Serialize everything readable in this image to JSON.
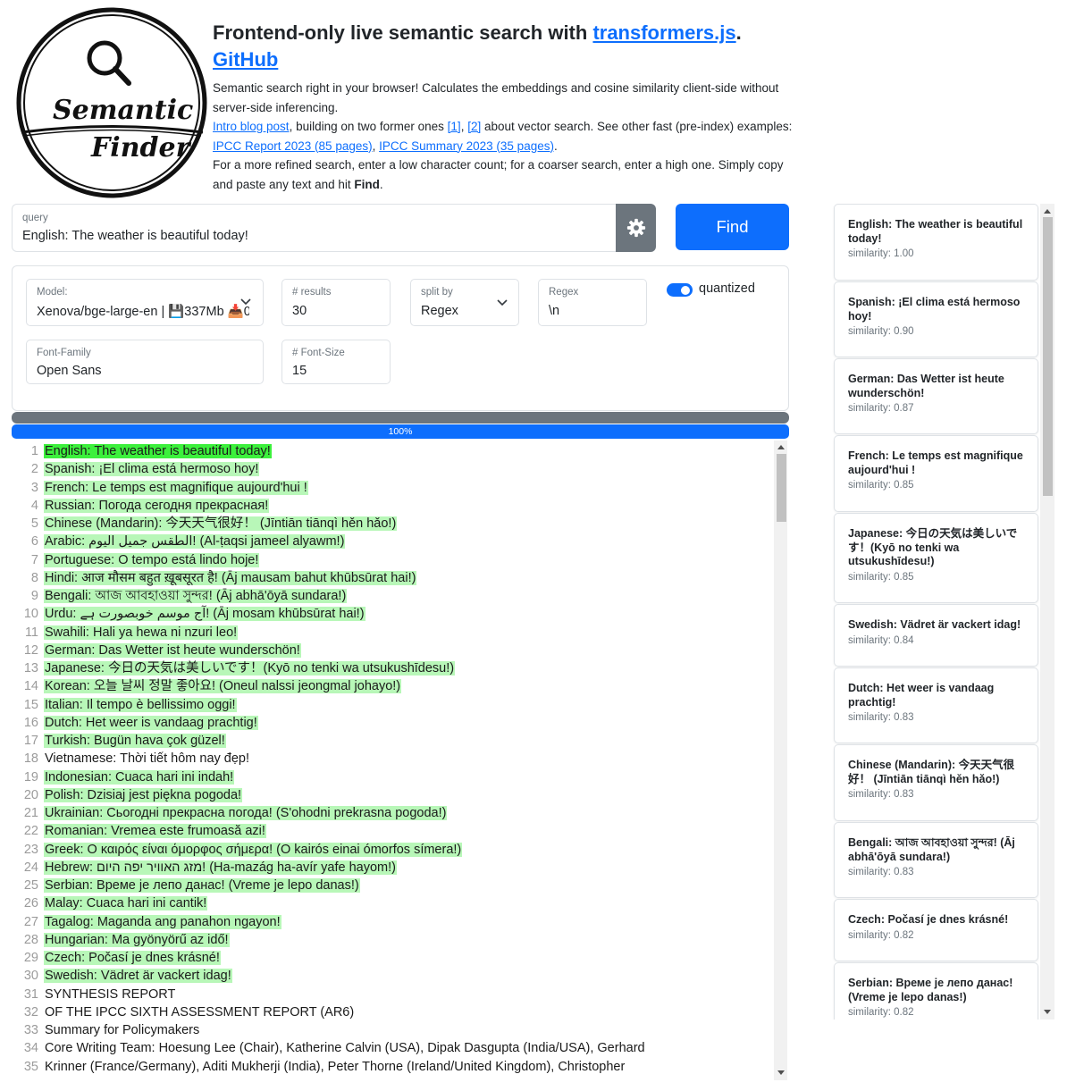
{
  "logo": {
    "word1": "Semantic",
    "word2": "Finder"
  },
  "header": {
    "title_prefix": "Frontend-only live semantic search with ",
    "title_link1": "transformers.js",
    "title_sep": ". ",
    "title_link2": "GitHub",
    "p1": "Semantic search right in your browser! Calculates the embeddings and cosine similarity client-side without server-side inferencing.",
    "p2_link_intro": "Intro blog post",
    "p2_text1": ", building on two former ones ",
    "p2_link_1": "[1]",
    "p2_text2": ", ",
    "p2_link_2": "[2]",
    "p2_text3": " about vector search. See other fast (pre-index) examples: ",
    "p2_link_ipcc_report": "IPCC Report 2023 (85 pages)",
    "p2_text4": ", ",
    "p2_link_ipcc_summary": "IPCC Summary 2023 (35 pages)",
    "p2_text5": ".",
    "p3_text": "For a more refined search, enter a low character count; for a coarser search, enter a high one. Simply copy and paste any text and hit ",
    "p3_bold": "Find",
    "p3_end": "."
  },
  "query": {
    "label": "query",
    "value": "English: The weather is beautiful today!"
  },
  "find_label": "Find",
  "settings": {
    "model_label": "Model:",
    "model_value": "Xenova/bge-large-en | 💾337Mb 📥0",
    "results_label": "# results",
    "results_value": "30",
    "split_label": "split by",
    "split_value": "Regex",
    "regex_label": "Regex",
    "regex_value": "\\n",
    "quantized_label": "quantized",
    "font_family_label": "Font-Family",
    "font_family_value": "Open Sans",
    "font_size_label": "# Font-Size",
    "font_size_value": "15"
  },
  "progress": {
    "label": "100%",
    "value": 100
  },
  "colors": {
    "primary": "#0d6efd",
    "secondary": "#6c757d",
    "top_highlight": "#3cf03c",
    "highlight": "#b8f7b8"
  },
  "editor": {
    "lines": [
      {
        "n": "1",
        "text": "English: The weather is beautiful today!",
        "level": "top"
      },
      {
        "n": "2",
        "text": "Spanish: ¡El clima está hermoso hoy!",
        "level": "high"
      },
      {
        "n": "3",
        "text": "French: Le temps est magnifique aujourd'hui !",
        "level": "high"
      },
      {
        "n": "4",
        "text": "Russian: Погода сегодня прекрасная!",
        "level": "high"
      },
      {
        "n": "5",
        "text": "Chinese (Mandarin): 今天天气很好！ (Jīntiān tiānqì hěn hǎo!)",
        "level": "high"
      },
      {
        "n": "6",
        "text": "Arabic: الطقس جميل اليوم! (Al-ṭaqsi jameel alyawm!)",
        "level": "high"
      },
      {
        "n": "7",
        "text": "Portuguese: O tempo está lindo hoje!",
        "level": "high"
      },
      {
        "n": "8",
        "text": "Hindi: आज मौसम बहुत ख़ूबसूरत है! (Āj mausam bahut khūbsūrat hai!)",
        "level": "high"
      },
      {
        "n": "9",
        "text": "Bengali: আজ আবহাওয়া সুন্দর! (Āj abhā'ōyā sundara!)",
        "level": "high"
      },
      {
        "n": "10",
        "text": "Urdu: آج موسم خوبصورت ہے! (Āj mosam khūbsūrat hai!)",
        "level": "high"
      },
      {
        "n": "11",
        "text": "Swahili: Hali ya hewa ni nzuri leo!",
        "level": "high"
      },
      {
        "n": "12",
        "text": "German: Das Wetter ist heute wunderschön!",
        "level": "high"
      },
      {
        "n": "13",
        "text": "Japanese: 今日の天気は美しいです！(Kyō no tenki wa utsukushīdesu!)",
        "level": "high"
      },
      {
        "n": "14",
        "text": "Korean: 오늘 날씨 정말 좋아요! (Oneul nalssi jeongmal johayo!)",
        "level": "high"
      },
      {
        "n": "15",
        "text": "Italian: Il tempo è bellissimo oggi!",
        "level": "high"
      },
      {
        "n": "16",
        "text": "Dutch: Het weer is vandaag prachtig!",
        "level": "high"
      },
      {
        "n": "17",
        "text": "Turkish: Bugün hava çok güzel!",
        "level": "high"
      },
      {
        "n": "18",
        "text": "Vietnamese: Thời tiết hôm nay đẹp!",
        "level": "none"
      },
      {
        "n": "19",
        "text": "Indonesian: Cuaca hari ini indah!",
        "level": "high"
      },
      {
        "n": "20",
        "text": "Polish: Dzisiaj jest piękna pogoda!",
        "level": "high"
      },
      {
        "n": "21",
        "text": "Ukrainian: Сьогодні прекрасна погода! (S'ohodni prekrasna pogoda!)",
        "level": "high"
      },
      {
        "n": "22",
        "text": "Romanian: Vremea este frumoasă azi!",
        "level": "high"
      },
      {
        "n": "23",
        "text": "Greek: Ο καιρός είναι όμορφος σήμερα! (O kairós einai ómorfos símera!)",
        "level": "high"
      },
      {
        "n": "24",
        "text": "Hebrew: מזג האוויר יפה היום! (Ha-mazág ha-avír yafe hayom!)",
        "level": "high"
      },
      {
        "n": "25",
        "text": "Serbian: Време је лепо данас! (Vreme je lepo danas!)",
        "level": "high"
      },
      {
        "n": "26",
        "text": "Malay: Cuaca hari ini cantik!",
        "level": "high"
      },
      {
        "n": "27",
        "text": "Tagalog: Maganda ang panahon ngayon!",
        "level": "high"
      },
      {
        "n": "28",
        "text": "Hungarian: Ma gyönyörű az idő!",
        "level": "high"
      },
      {
        "n": "29",
        "text": "Czech: Počasí je dnes krásné!",
        "level": "high"
      },
      {
        "n": "30",
        "text": "Swedish: Vädret är vackert idag!",
        "level": "high"
      },
      {
        "n": "31",
        "text": "SYNTHESIS REPORT",
        "level": "none"
      },
      {
        "n": "32",
        "text": "OF THE IPCC SIXTH ASSESSMENT REPORT (AR6)",
        "level": "none"
      },
      {
        "n": "33",
        "text": "Summary for Policymakers",
        "level": "none"
      },
      {
        "n": "34",
        "text": "Core Writing Team: Hoesung Lee (Chair), Katherine Calvin (USA), Dipak Dasgupta (India/USA), Gerhard",
        "level": "none"
      },
      {
        "n": "35",
        "text": "Krinner (France/Germany), Aditi Mukherji (India), Peter Thorne (Ireland/United Kingdom), Christopher",
        "level": "none"
      }
    ]
  },
  "results": [
    {
      "text": "English: The weather is beautiful today!",
      "similarity": "similarity: 1.00"
    },
    {
      "text": "Spanish: ¡El clima está hermoso hoy!",
      "similarity": "similarity: 0.90"
    },
    {
      "text": "German: Das Wetter ist heute wunderschön!",
      "similarity": "similarity: 0.87"
    },
    {
      "text": "French: Le temps est magnifique aujourd'hui !",
      "similarity": "similarity: 0.85"
    },
    {
      "text": "Japanese: 今日の天気は美しいです！(Kyō no tenki wa utsukushīdesu!)",
      "similarity": "similarity: 0.85"
    },
    {
      "text": "Swedish: Vädret är vackert idag!",
      "similarity": "similarity: 0.84"
    },
    {
      "text": "Dutch: Het weer is vandaag prachtig!",
      "similarity": "similarity: 0.83"
    },
    {
      "text": "Chinese (Mandarin): 今天天气很好！ (Jīntiān tiānqì hěn hǎo!)",
      "similarity": "similarity: 0.83"
    },
    {
      "text": "Bengali: আজ আবহাওয়া সুন্দর! (Āj abhā'ōyā sundara!)",
      "similarity": "similarity: 0.83"
    },
    {
      "text": "Czech: Počasí je dnes krásné!",
      "similarity": "similarity: 0.82"
    },
    {
      "text": "Serbian: Време је лепо данас! (Vreme je lepo danas!)",
      "similarity": "similarity: 0.82"
    }
  ]
}
